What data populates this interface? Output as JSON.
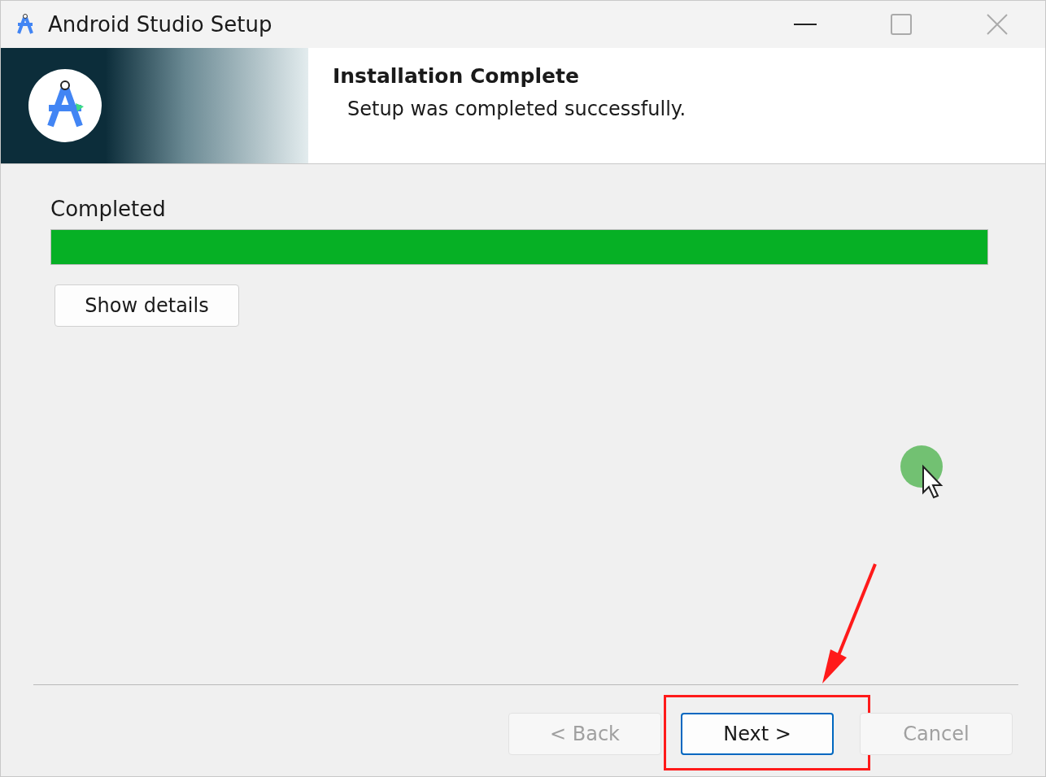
{
  "window": {
    "title": "Android Studio Setup"
  },
  "header": {
    "title": "Installation Complete",
    "subtitle": "Setup was completed successfully."
  },
  "progress": {
    "label": "Completed",
    "level": 1
  },
  "details_button": {
    "label": "Show details"
  },
  "buttons": [
    {
      "label": "< Back",
      "disabled": true,
      "focused": false,
      "highlighted": false
    },
    {
      "label": "Next >",
      "disabled": false,
      "focused": true,
      "highlighted": true
    },
    {
      "label": "Cancel",
      "disabled": true,
      "focused": false,
      "highlighted": false
    }
  ]
}
